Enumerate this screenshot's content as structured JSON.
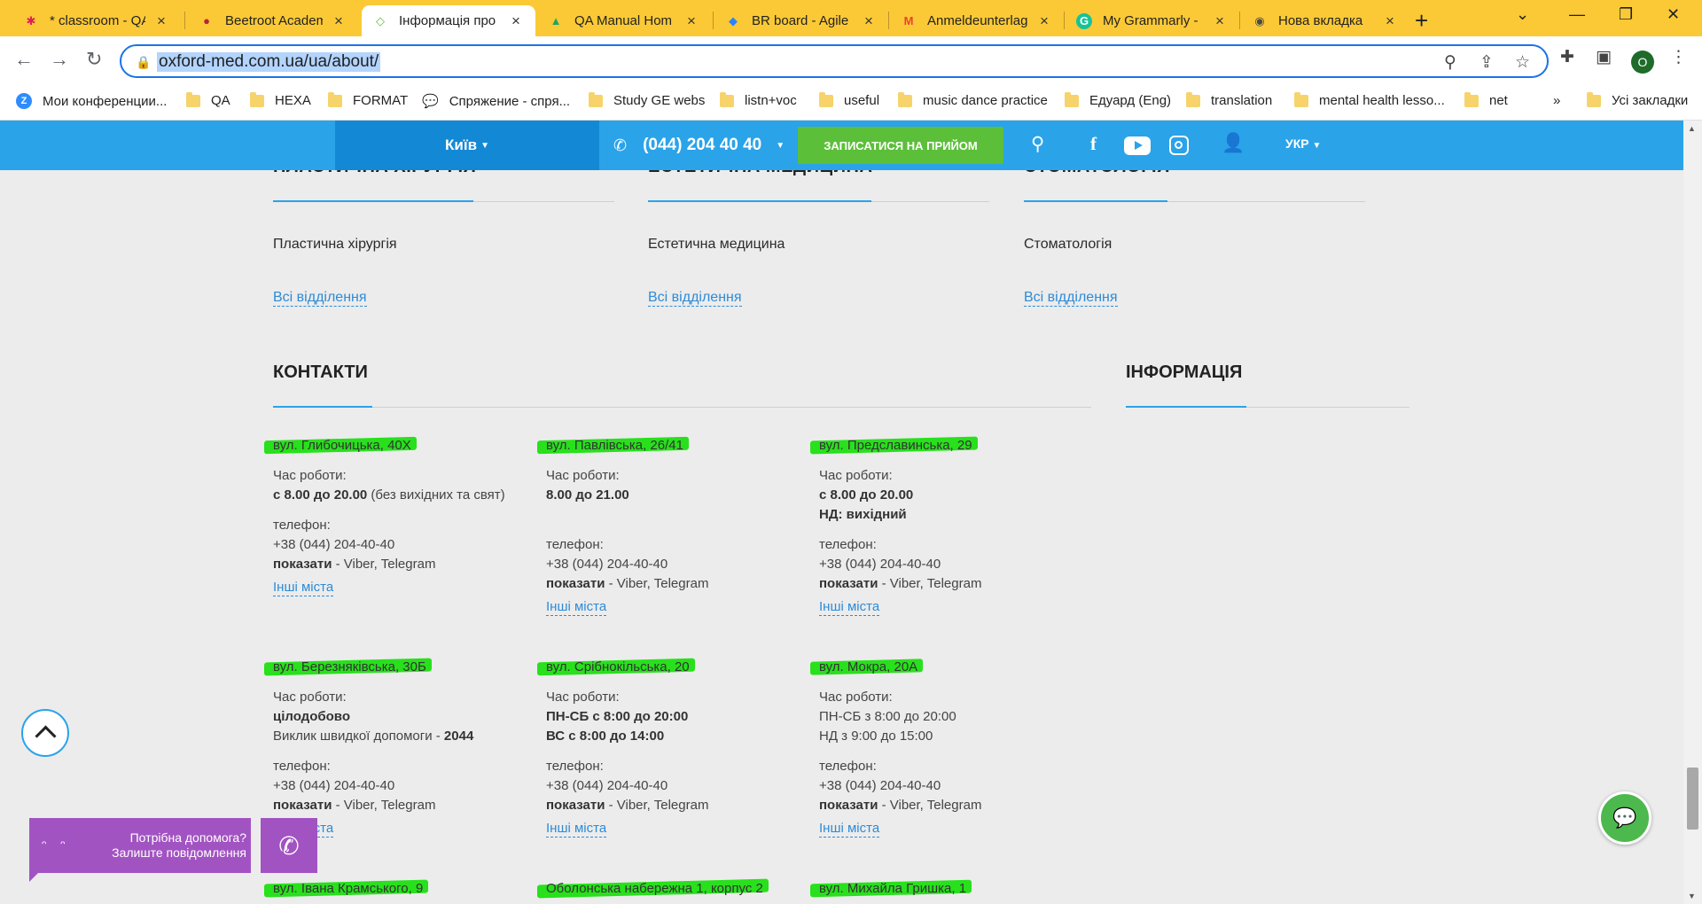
{
  "browser": {
    "tabs": [
      {
        "label": "* classroom - QA",
        "icon": "slack-icon",
        "color": "#e01e5a"
      },
      {
        "label": "Beetroot Academ",
        "icon": "beetroot-icon",
        "color": "#b8243a"
      },
      {
        "label": "Інформація про",
        "icon": "diamond-icon",
        "color": "#5cbf3a",
        "active": true
      },
      {
        "label": "QA Manual Hom",
        "icon": "google-drive-icon",
        "color": "#1fa463"
      },
      {
        "label": "BR board - Agile",
        "icon": "jira-icon",
        "color": "#2684ff"
      },
      {
        "label": "Anmeldeunterlag",
        "icon": "gmail-icon",
        "color": "#ea4335"
      },
      {
        "label": "My Grammarly -",
        "icon": "grammarly-icon",
        "color": "#15c39a"
      },
      {
        "label": "Нова вкладка",
        "icon": "chrome-icon",
        "color": "#4a4a4a"
      }
    ],
    "url": "oxford-med.com.ua/ua/about/",
    "profile_initial": "O",
    "bookmarks": [
      {
        "label": "Мои конференции...",
        "icon": "zoom-icon"
      },
      {
        "label": "QA",
        "icon": "folder-icon"
      },
      {
        "label": "HEXA",
        "icon": "folder-icon"
      },
      {
        "label": "FORMAT",
        "icon": "folder-icon"
      },
      {
        "label": "Спряжение - спря...",
        "icon": "chat-bubble-icon"
      },
      {
        "label": "Study GE webs",
        "icon": "folder-icon"
      },
      {
        "label": "listn+voc",
        "icon": "folder-icon"
      },
      {
        "label": "useful",
        "icon": "folder-icon"
      },
      {
        "label": "music dance practice",
        "icon": "folder-icon"
      },
      {
        "label": "Едуард (Eng)",
        "icon": "folder-icon"
      },
      {
        "label": "translation",
        "icon": "folder-icon"
      },
      {
        "label": "mental health lesso...",
        "icon": "folder-icon"
      },
      {
        "label": "net",
        "icon": "folder-icon"
      }
    ],
    "bookmarks_overflow": "»",
    "all_bookmarks": "Усі закладки"
  },
  "header": {
    "city": "Київ",
    "phone": "(044) 204 40 40",
    "signup_button": "ЗАПИСАТИСЯ НА ПРИЙОМ",
    "lang": "УКР"
  },
  "departments": [
    {
      "heading": "ПЛАСТИЧНА ХІРУРГІЯ",
      "item": "Пластична хірургія",
      "link": "Всі відділення"
    },
    {
      "heading": "ЕСТЕТИЧНА МЕДИЦИНА",
      "item": "Естетична медицина",
      "link": "Всі відділення"
    },
    {
      "heading": "СТОМАТОЛОГІЯ",
      "item": "Стоматологія",
      "link": "Всі відділення"
    }
  ],
  "contacts_heading": "КОНТАКТИ",
  "info_heading": "ІНФОРМАЦІЯ",
  "labels": {
    "hours": "Час роботи:",
    "phone": "телефон:",
    "show": "показати",
    "messengers": " - Viber, Telegram",
    "other_cities": "Інші міста"
  },
  "contacts": [
    {
      "street": "вул. Глибочицька, 40Х",
      "hours_bold": "с 8.00 до 20.00",
      "hours_rest": " (без вихідних та свят)",
      "hours2_bold": "",
      "hours2_rest": "",
      "phone": "+38 (044) 204-40-40"
    },
    {
      "street": "вул. Павлівська, 26/41",
      "hours_bold": "8.00 до 21.00",
      "hours_rest": "",
      "hours2_bold": "",
      "hours2_rest": "",
      "phone": "+38 (044) 204-40-40"
    },
    {
      "street": "вул. Предславинська, 29",
      "hours_bold": "с 8.00 до 20.00",
      "hours_rest": "",
      "hours2_bold": "НД: вихідний",
      "hours2_rest": "",
      "phone": "+38 (044) 204-40-40"
    },
    {
      "street": "вул. Березняківська, 30Б",
      "hours_bold": "цілодобово",
      "hours_rest": "",
      "hours2_bold": "",
      "hours2_rest": "Виклик швидкої допомоги - ",
      "hours2_tail": "2044",
      "phone": "+38 (044) 204-40-40"
    },
    {
      "street": "вул. Срібнокільська, 20",
      "hours_bold": "ПН-СБ с 8:00 до 20:00",
      "hours_rest": "",
      "hours2_bold": "ВС с 8:00 до 14:00",
      "hours2_rest": "",
      "phone": "+38 (044) 204-40-40"
    },
    {
      "street": "вул. Мокра, 20А",
      "hours_bold": "",
      "hours_rest": "ПН-СБ з 8:00 до 20:00",
      "hours2_bold": "",
      "hours2_rest": "НД з 9:00 до 15:00",
      "phone": "+38 (044) 204-40-40"
    },
    {
      "street": "вул. Івана Крамського, 9"
    },
    {
      "street": "Оболонська набережна 1, корпус 2"
    },
    {
      "street": "вул. Михайла Гришка, 1"
    }
  ],
  "help_widget": {
    "line1": "Потрібна допомога?",
    "line2": "Залиште повідомлення",
    "eyes": "ᵔ ᵔ"
  },
  "colors": {
    "site_blue": "#2aa3e9",
    "city_blue": "#1389d6",
    "green_button": "#5cbf3a",
    "highlight": "#28e01c",
    "help_purple": "#a253c2",
    "tabbar": "#fbc935"
  }
}
